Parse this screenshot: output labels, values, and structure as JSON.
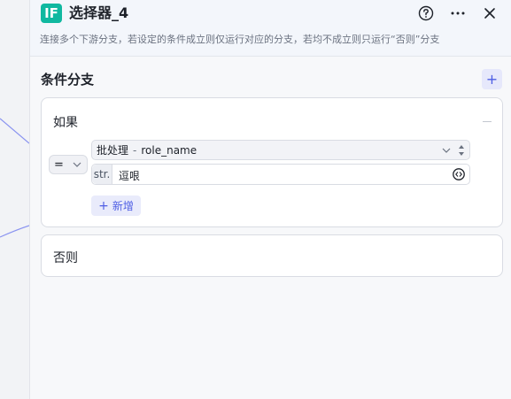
{
  "header": {
    "badge": "IF",
    "title": "选择器_4",
    "description": "连接多个下游分支，若设定的条件成立则仅运行对应的分支，若均不成立则只运行“否则”分支",
    "icons": [
      "help-icon",
      "more-icon",
      "close-icon"
    ]
  },
  "section": {
    "title": "条件分支",
    "add_icon": "+"
  },
  "if_branch": {
    "label": "如果",
    "condition": {
      "operator": "=",
      "variable_node": "批处理",
      "variable_sep": "-",
      "variable_name": "role_name",
      "value_type": "str.",
      "value": "逗哏"
    },
    "add_label": "新增",
    "add_icon": "+"
  },
  "else_branch": {
    "label": "否则"
  },
  "colors": {
    "accent": "#4e5ee4",
    "badge": "#10b8a0"
  }
}
